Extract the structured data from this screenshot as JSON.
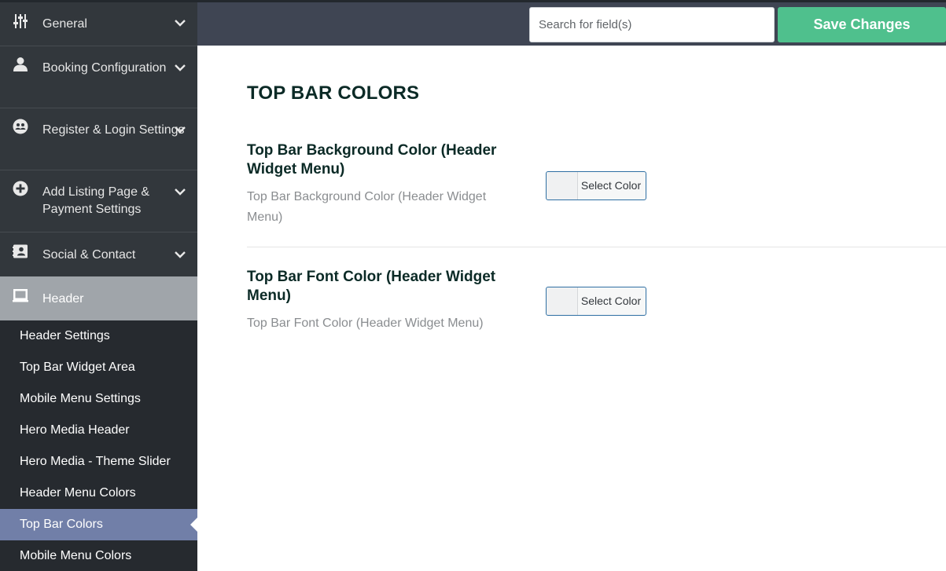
{
  "sidebar": {
    "items": [
      {
        "label": "General",
        "icon": "sliders-icon"
      },
      {
        "label": "Booking Configuration",
        "icon": "person-icon"
      },
      {
        "label": "Register & Login Settings",
        "icon": "users-circle-icon"
      },
      {
        "label": "Add Listing Page & Payment Settings",
        "icon": "plus-circle-icon"
      },
      {
        "label": "Social & Contact",
        "icon": "contact-card-icon"
      },
      {
        "label": "Header",
        "icon": "laptop-icon"
      }
    ],
    "subitems": [
      "Header Settings",
      "Top Bar Widget Area",
      "Mobile Menu Settings",
      "Hero Media Header",
      "Hero Media - Theme Slider",
      "Header Menu Colors",
      "Top Bar Colors",
      "Mobile Menu Colors"
    ],
    "active_subitem": "Top Bar Colors"
  },
  "topbar": {
    "search_placeholder": "Search for field(s)",
    "save_label": "Save Changes"
  },
  "main": {
    "section_title": "TOP BAR COLORS",
    "fields": [
      {
        "label": "Top Bar Background Color (Header Widget Menu)",
        "description": "Top Bar Background Color (Header Widget Menu)",
        "button_label": "Select Color"
      },
      {
        "label": "Top Bar Font Color (Header Widget Menu)",
        "description": "Top Bar Font Color (Header Widget Menu)",
        "button_label": "Select Color"
      }
    ]
  },
  "colors": {
    "sidebar_bg": "#32373c",
    "header_active_bg": "#a0a5aa",
    "subnav_active_bg": "#717fa8",
    "topbar_bg": "#3f4553",
    "save_button_bg": "#4fc08d",
    "title_text": "#0b2a26"
  }
}
